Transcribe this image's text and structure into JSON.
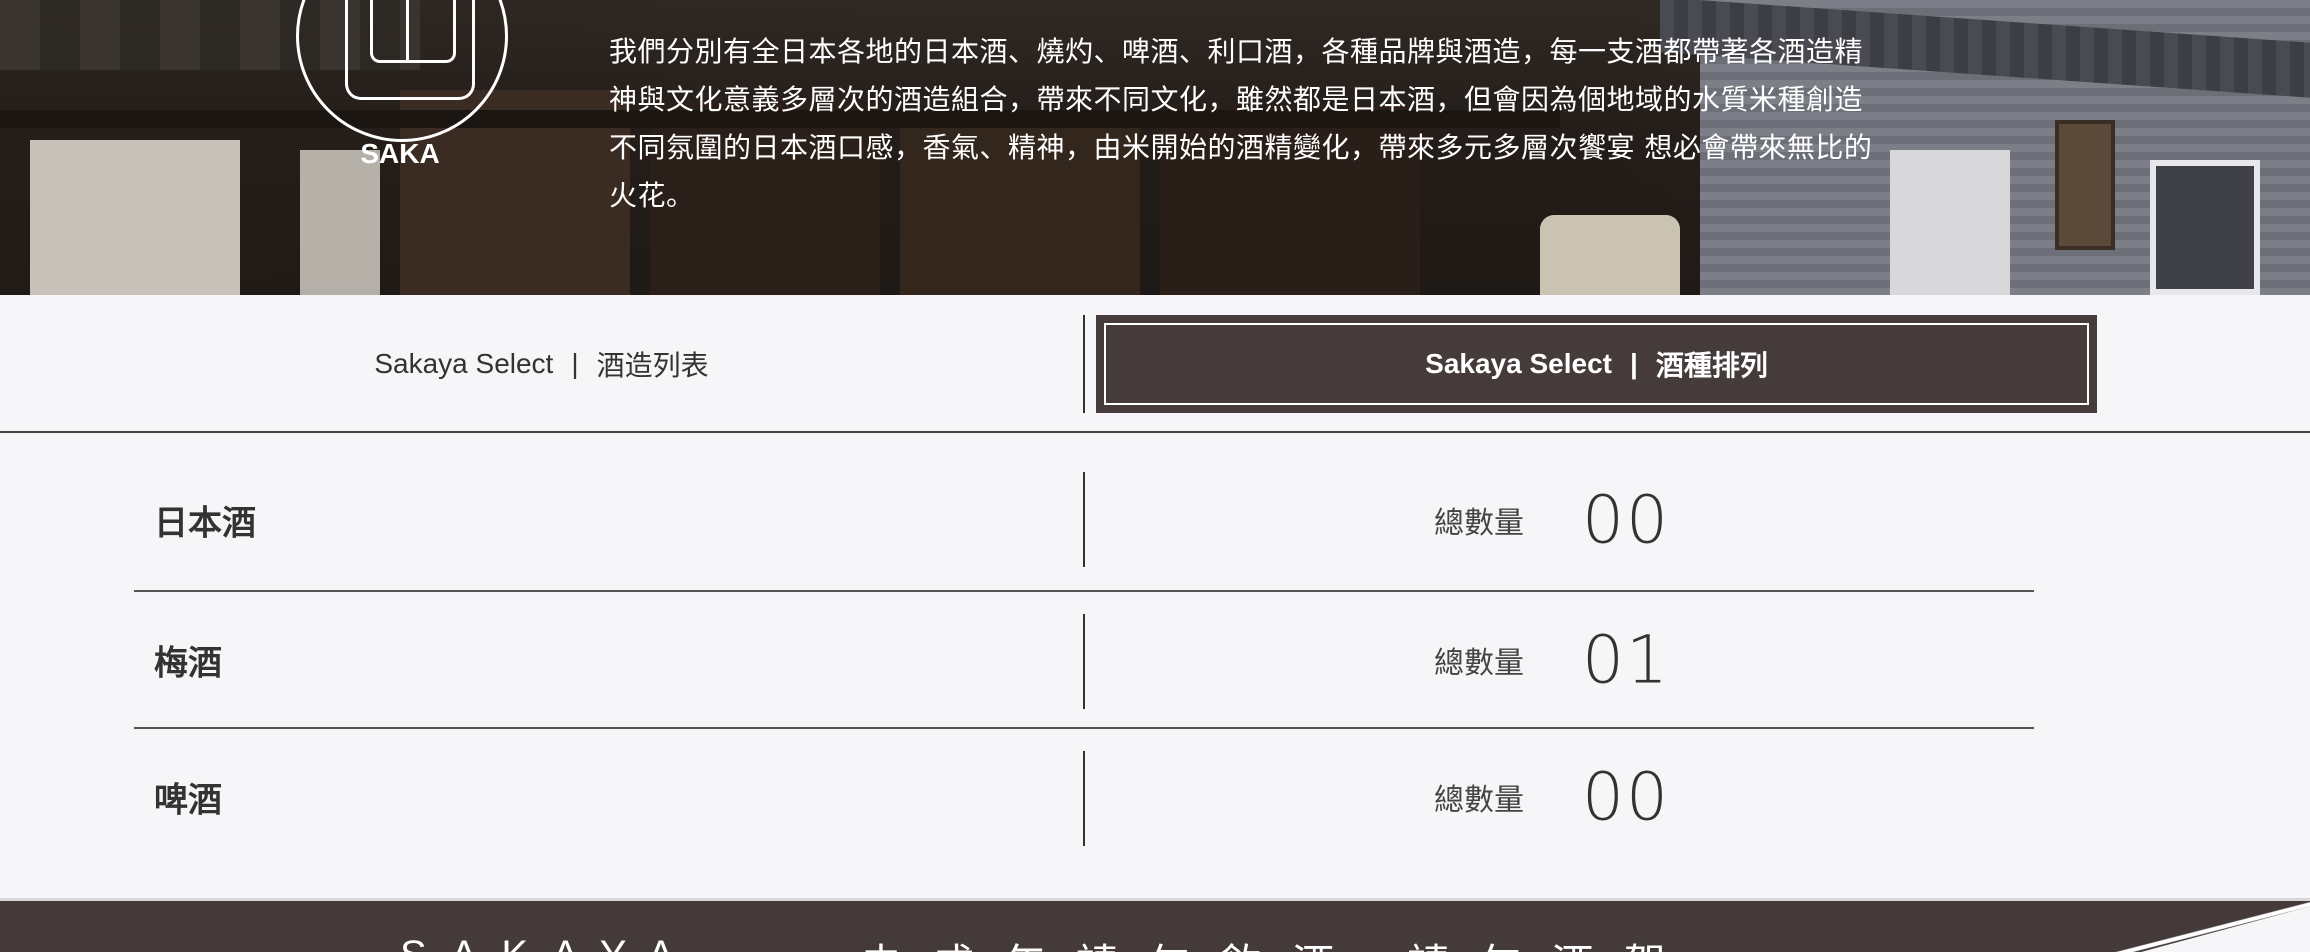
{
  "hero": {
    "logo_text": "SAKA",
    "description": "我們分別有全日本各地的日本酒、燒灼、啤酒、利口酒，各種品牌與酒造，每一支酒都帶著各酒造精神與文化意義多層次的酒造組合，帶來不同文化，雖然都是日本酒，但會因為個地域的水質米種創造不同氛圍的日本酒口感，香氣、精神，由米開始的酒精變化，帶來多元多層次饗宴 想必會帶來無比的火花。"
  },
  "tabs": {
    "brewery_list": {
      "brand": "Sakaya Select",
      "separator": "|",
      "label": "酒造列表"
    },
    "liquor_types": {
      "brand": "Sakaya Select",
      "separator": "|",
      "label": "酒種排列",
      "active": true
    }
  },
  "categories": [
    {
      "name": "日本酒",
      "count_label": "總數量",
      "count": "00"
    },
    {
      "name": "梅酒",
      "count_label": "總數量",
      "count": "01"
    },
    {
      "name": "啤酒",
      "count_label": "總數量",
      "count": "00"
    }
  ],
  "footer": {
    "brand": "SAKAYA",
    "slogan": "未成年請勿飲酒 請勿酒駕"
  },
  "colors": {
    "accent_dark": "#453b3b",
    "background": "#f6f5f7",
    "text": "#333333"
  }
}
